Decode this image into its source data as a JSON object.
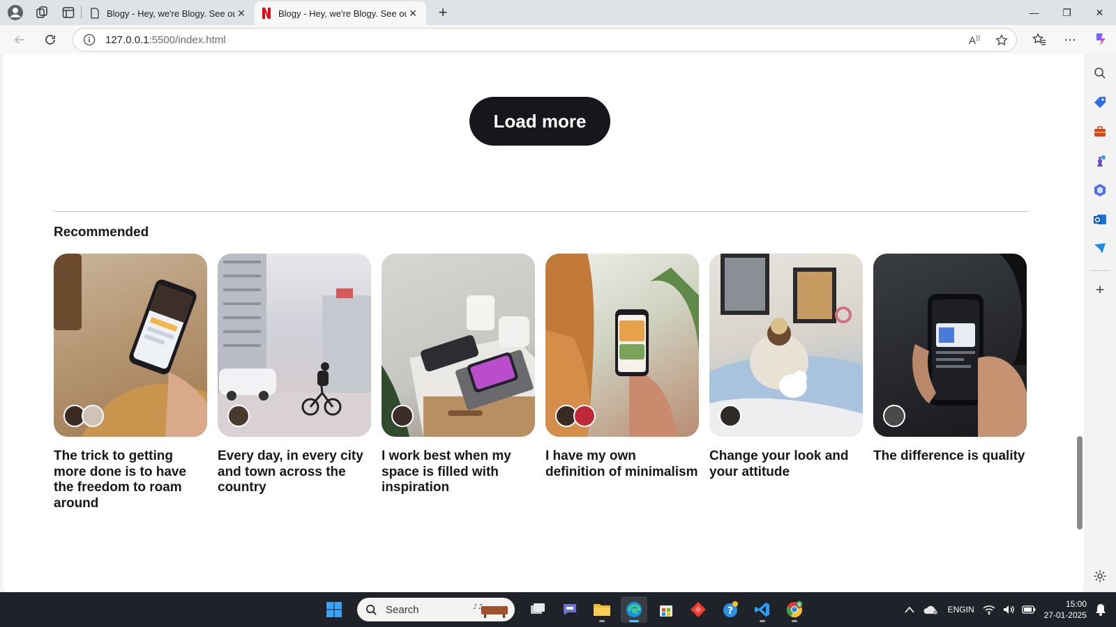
{
  "browser": {
    "tabs": [
      {
        "title": "Blogy - Hey, we're Blogy. See our",
        "active": false
      },
      {
        "title": "Blogy - Hey, we're Blogy. See our",
        "active": true
      }
    ],
    "url_host": "127.0.0.1",
    "url_rest": ":5500/index.html"
  },
  "page": {
    "load_more_label": "Load more",
    "section_title": "Recommended",
    "cards": [
      {
        "title": "The trick to getting more done is to have the freedom to roam around"
      },
      {
        "title": "Every day, in every city and town across the country"
      },
      {
        "title": "I work best when my space is filled with inspiration"
      },
      {
        "title": "I have my own definition of minimalism"
      },
      {
        "title": "Change your look and your attitude"
      },
      {
        "title": "The difference is quality"
      }
    ]
  },
  "taskbar": {
    "search_placeholder": "Search",
    "lang_top": "ENG",
    "lang_bottom": "IN",
    "time": "15:00",
    "date": "27-01-2025"
  },
  "colors": {
    "accent_dark": "#15171c",
    "taskbar_bg": "#1f2228",
    "edge_accent": "#0078d4"
  }
}
